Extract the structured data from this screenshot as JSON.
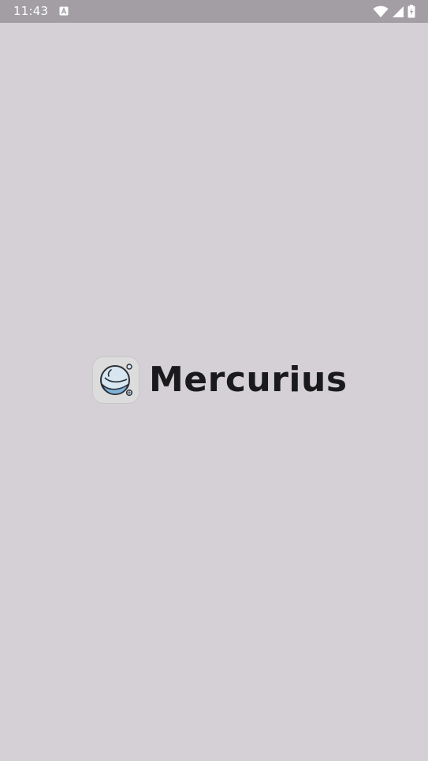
{
  "status_bar": {
    "time": "11:43",
    "notification_icon": "a-letter-icon",
    "wifi_icon": "wifi-icon",
    "signal_icon": "cellular-signal-icon",
    "battery_icon": "battery-charging-icon"
  },
  "splash": {
    "app_icon": "mercurius-planet-logo-icon",
    "app_name": "Mercurius",
    "background_color": "#d4d0d5"
  }
}
